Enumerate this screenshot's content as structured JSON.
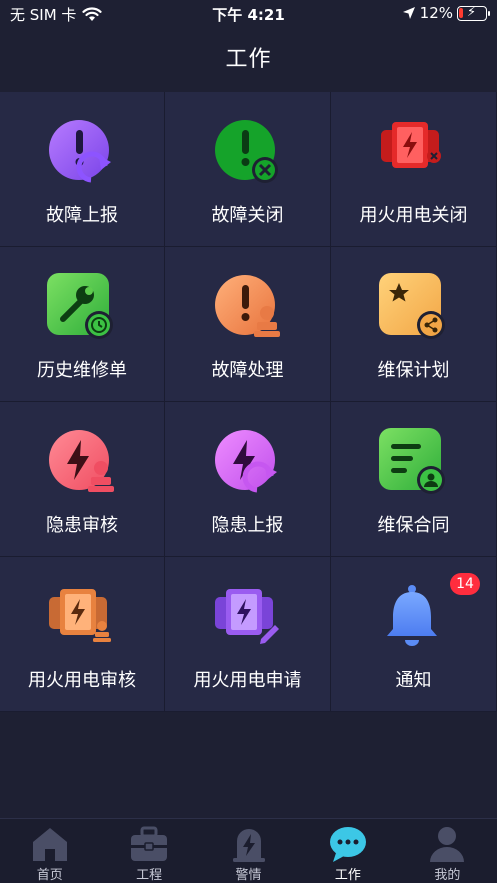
{
  "status": {
    "carrier": "无 SIM 卡",
    "time": "下午 4:21",
    "battery": "12%"
  },
  "header": {
    "title": "工作"
  },
  "grid": {
    "items": [
      {
        "label": "故障上报",
        "icon": "fault-report-icon"
      },
      {
        "label": "故障关闭",
        "icon": "fault-close-icon"
      },
      {
        "label": "用火用电关闭",
        "icon": "fire-electric-close-icon"
      },
      {
        "label": "历史维修单",
        "icon": "repair-history-icon"
      },
      {
        "label": "故障处理",
        "icon": "fault-handle-icon"
      },
      {
        "label": "维保计划",
        "icon": "maintenance-plan-icon"
      },
      {
        "label": "隐患审核",
        "icon": "hazard-review-icon"
      },
      {
        "label": "隐患上报",
        "icon": "hazard-report-icon"
      },
      {
        "label": "维保合同",
        "icon": "maintenance-contract-icon"
      },
      {
        "label": "用火用电审核",
        "icon": "fire-electric-review-icon"
      },
      {
        "label": "用火用电申请",
        "icon": "fire-electric-apply-icon"
      },
      {
        "label": "通知",
        "icon": "bell-icon",
        "badge": "14"
      }
    ]
  },
  "tabs": [
    {
      "label": "首页",
      "icon": "home-icon"
    },
    {
      "label": "工程",
      "icon": "briefcase-icon"
    },
    {
      "label": "警情",
      "icon": "alarm-icon"
    },
    {
      "label": "工作",
      "icon": "chat-icon",
      "active": true
    },
    {
      "label": "我的",
      "icon": "user-icon"
    }
  ],
  "colors": {
    "background": "#1e2033",
    "cell": "#262945",
    "accent_active": "#3cc7e6",
    "badge": "#ff2d3e"
  }
}
